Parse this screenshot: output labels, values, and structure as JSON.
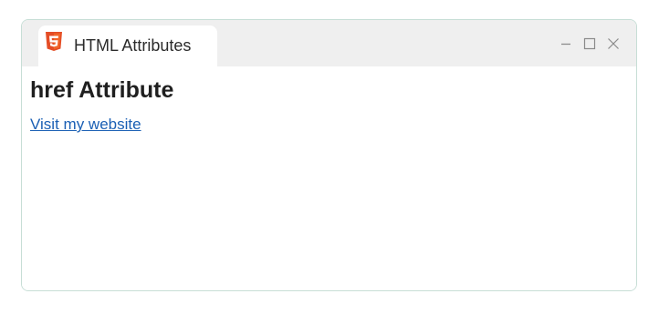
{
  "window": {
    "tab_title": "HTML Attributes",
    "tab_icon": "html5-icon",
    "controls": {
      "minimize_icon": "minimize-icon",
      "maximize_icon": "maximize-icon",
      "close_icon": "close-icon"
    }
  },
  "page": {
    "heading": "href Attribute",
    "link_text": "Visit my website"
  },
  "colors": {
    "html5_orange": "#e44d26",
    "html5_orange_light": "#f16529",
    "link": "#1a5fb4",
    "titlebar": "#efefef",
    "window_border": "#c7ded6"
  }
}
